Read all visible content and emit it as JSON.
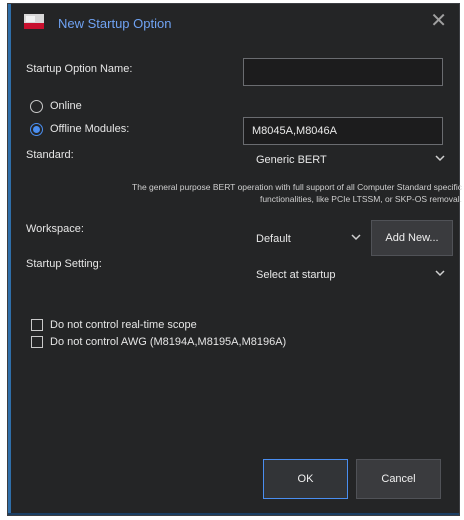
{
  "dialog": {
    "title": "New Startup Option",
    "close_icon": "close-icon"
  },
  "form": {
    "name_label": "Startup Option Name:",
    "name_value": "",
    "online_label": "Online",
    "offline_label": "Offline Modules:",
    "offline_selected": true,
    "offline_modules_value": "M8045A,M8046A",
    "standard_label": "Standard:",
    "standard_value": "Generic BERT",
    "standard_description_line1": "The general purpose BERT operation with full support of all Computer Standard specific",
    "standard_description_line2": "functionalities, like PCIe LTSSM, or SKP-OS removal.",
    "workspace_label": "Workspace:",
    "workspace_value": "Default",
    "add_new_label": "Add New...",
    "startup_setting_label": "Startup Setting:",
    "startup_setting_value": "Select at startup",
    "no_scope_label": "Do not control real-time scope",
    "no_awg_label": "Do not control AWG (M8194A,M8195A,M8196A)"
  },
  "buttons": {
    "ok_label": "OK",
    "cancel_label": "Cancel"
  },
  "colors": {
    "background": "#242526",
    "title_text": "#6fa2f2",
    "accent": "#4a8ef0",
    "side_accent": "#2f6ea8"
  }
}
